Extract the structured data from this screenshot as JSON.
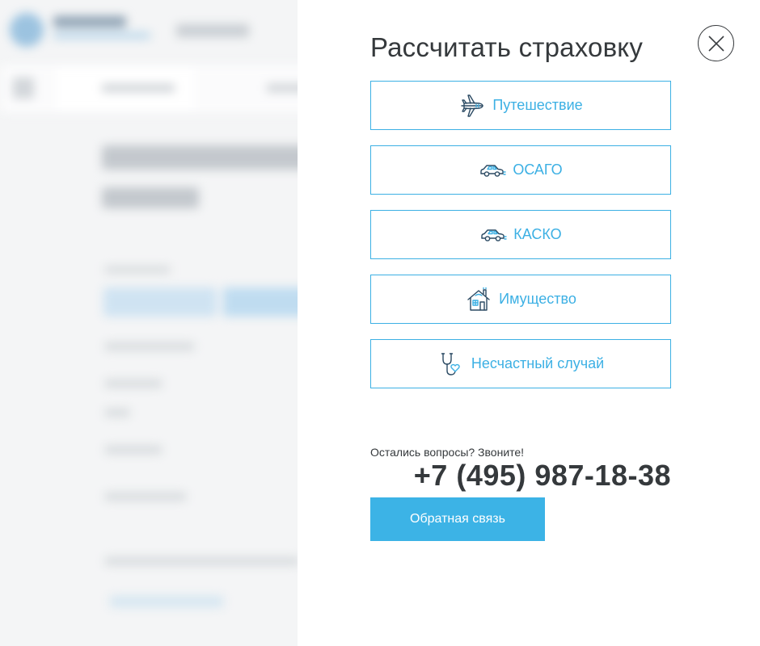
{
  "modal": {
    "title": "Рассчитать страховку",
    "options": [
      {
        "label": "Путешествие",
        "icon": "airplane-icon"
      },
      {
        "label": "ОСАГО",
        "icon": "car-icon"
      },
      {
        "label": "КАСКО",
        "icon": "car-icon"
      },
      {
        "label": "Имущество",
        "icon": "house-icon"
      },
      {
        "label": "Несчастный случай",
        "icon": "stethoscope-heart-icon"
      }
    ],
    "contact": {
      "question": "Остались вопросы? Звоните!",
      "phone": "+7 (495) 987-18-38",
      "callback_label": "Обратная связь"
    }
  },
  "colors": {
    "accent": "#3cb0e4",
    "button": "#3cb3e6",
    "text": "#35393c",
    "icon_dark": "#2b4a63"
  }
}
